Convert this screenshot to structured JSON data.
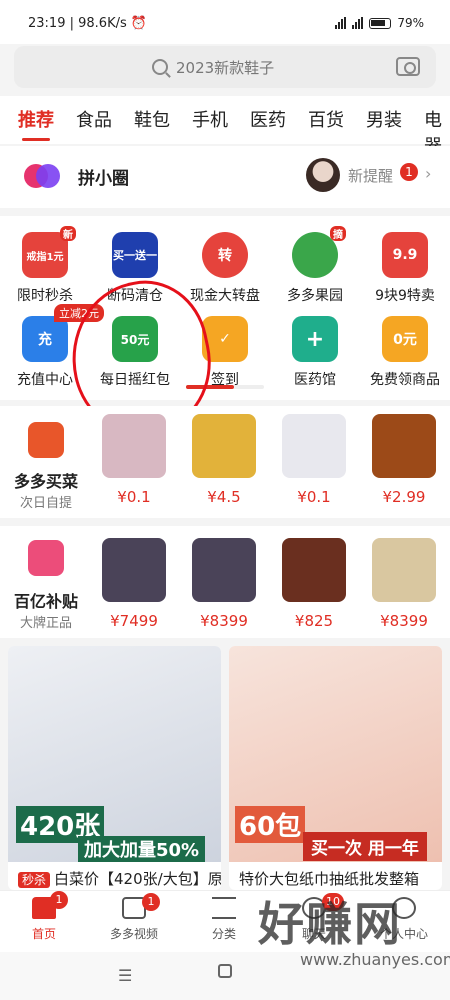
{
  "status_bar": {
    "time": "23:19",
    "speed": "98.6K/s",
    "battery": "79%"
  },
  "search": {
    "placeholder": "2023新款鞋子"
  },
  "tabs": [
    "推荐",
    "食品",
    "鞋包",
    "手机",
    "医药",
    "百货",
    "男装",
    "电器"
  ],
  "circle": {
    "title": "拼小圈",
    "remind_label": "新提醒",
    "remind_count": "1"
  },
  "grid": {
    "row1": [
      {
        "label": "限时秒杀",
        "icon_text": "戒指1元",
        "badge": "新",
        "color": "#e5433c"
      },
      {
        "label": "断码清仓",
        "icon_text": "买一送一",
        "color": "#1f3fae"
      },
      {
        "label": "现金大转盘",
        "icon_text": "转",
        "color": "#e5433c"
      },
      {
        "label": "多多果园",
        "icon_text": "",
        "badge": "摘",
        "color": "#3aa64a"
      },
      {
        "label": "9块9特卖",
        "icon_text": "9.9",
        "color": "#e5433c"
      }
    ],
    "row2": [
      {
        "label": "充值中心",
        "icon_text": "充",
        "color": "#2b7fe8"
      },
      {
        "label": "每日摇红包",
        "icon_text": "50元",
        "color": "#27a24a"
      },
      {
        "label": "签到",
        "icon_text": "✓",
        "color": "#f5a623"
      },
      {
        "label": "医药馆",
        "icon_text": "+",
        "color": "#1fae8c"
      },
      {
        "label": "免费领商品",
        "icon_text": "0元",
        "color": "#f5a623"
      }
    ],
    "promo_pill": "立减2元"
  },
  "strip1": {
    "title": "多多买菜",
    "subtitle": "次日自提",
    "products": [
      {
        "price": "¥0.1",
        "color": "#d8b8c2"
      },
      {
        "price": "¥4.5",
        "color": "#e2b23a"
      },
      {
        "price": "¥0.1",
        "color": "#e8e8ee"
      },
      {
        "price": "¥2.99",
        "color": "#9c4a18"
      }
    ]
  },
  "strip2": {
    "title": "百亿补贴",
    "subtitle": "大牌正品",
    "products": [
      {
        "price": "¥7499",
        "color": "#4a4358"
      },
      {
        "price": "¥8399",
        "color": "#4a4358"
      },
      {
        "price": "¥825",
        "color": "#6a2f1f"
      },
      {
        "price": "¥8399",
        "color": "#d9c7a0"
      }
    ]
  },
  "cards": [
    {
      "tag": "秒杀",
      "caption": "白菜价【420张/大包】原",
      "banner": "加大加量50%",
      "big": "420张",
      "color": "#d9dde6"
    },
    {
      "caption": "特价大包纸巾抽纸批发整箱",
      "banner": "买一次 用一年",
      "big": "60包",
      "color": "#f3d2c8"
    }
  ],
  "nav": [
    {
      "label": "首页",
      "badge": "1"
    },
    {
      "label": "多多视频",
      "badge": "1"
    },
    {
      "label": "分类",
      "badge": ""
    },
    {
      "label": "聊天",
      "badge": "10"
    },
    {
      "label": "个人中心",
      "badge": ""
    }
  ],
  "watermark": {
    "text": "好赚网",
    "sub": "www.zhuanyes.com"
  }
}
